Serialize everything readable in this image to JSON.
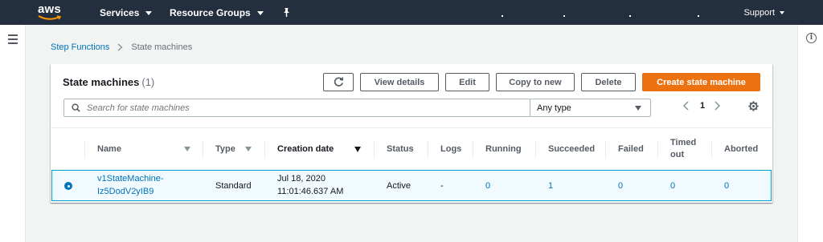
{
  "nav": {
    "logo": "aws",
    "services": "Services",
    "resource_groups": "Resource Groups",
    "support": "Support"
  },
  "breadcrumb": {
    "parent": "Step Functions",
    "current": "State machines"
  },
  "panel": {
    "title": "State machines",
    "count": "(1)",
    "buttons": {
      "view_details": "View details",
      "edit": "Edit",
      "copy_to_new": "Copy to new",
      "delete": "Delete",
      "create": "Create state machine"
    },
    "search_placeholder": "Search for state machines",
    "type_filter": "Any type",
    "page": "1"
  },
  "table": {
    "columns": {
      "name": "Name",
      "type": "Type",
      "creation_date": "Creation date",
      "status": "Status",
      "logs": "Logs",
      "running": "Running",
      "succeeded": "Succeeded",
      "failed": "Failed",
      "timed_out_1": "Timed",
      "timed_out_2": "out",
      "aborted": "Aborted"
    },
    "rows": [
      {
        "name_line1": "v1StateMachine-",
        "name_line2": "Iz5DodV2yIB9",
        "type": "Standard",
        "date_line1": "Jul 18, 2020",
        "date_line2": "11:01:46.637 AM",
        "status": "Active",
        "logs": "-",
        "running": "0",
        "succeeded": "1",
        "failed": "0",
        "timed_out": "0",
        "aborted": "0"
      }
    ]
  },
  "colors": {
    "nav_bg": "#232f3e",
    "primary": "#ec7211",
    "link": "#0073bb",
    "selected_row_bg": "#f1faff",
    "selected_row_border": "#00a1c9"
  },
  "icons": [
    "hamburger-icon",
    "info-icon",
    "pin-icon",
    "refresh-icon",
    "search-icon",
    "chevron-left-icon",
    "chevron-right-icon",
    "gear-icon"
  ]
}
